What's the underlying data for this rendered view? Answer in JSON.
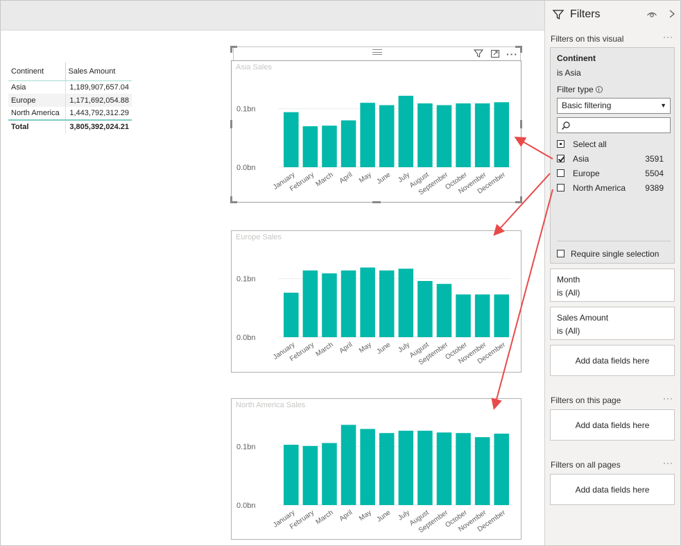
{
  "table": {
    "headers": [
      "Continent",
      "Sales Amount"
    ],
    "rows": [
      [
        "Asia",
        "1,189,907,657.04"
      ],
      [
        "Europe",
        "1,171,692,054.88"
      ],
      [
        "North America",
        "1,443,792,312.29"
      ]
    ],
    "total": [
      "Total",
      "3,805,392,024.21"
    ]
  },
  "charts_meta": {
    "bar_color": "#01b8aa",
    "arrow_color": "#e84a4a"
  },
  "chart_data": [
    {
      "type": "bar",
      "title": "Asia Sales",
      "categories": [
        "January",
        "February",
        "March",
        "April",
        "May",
        "June",
        "July",
        "August",
        "September",
        "October",
        "November",
        "December"
      ],
      "values": [
        0.094,
        0.07,
        0.071,
        0.08,
        0.11,
        0.106,
        0.122,
        0.109,
        0.106,
        0.109,
        0.109,
        0.111
      ],
      "ylim": [
        0,
        0.16
      ],
      "yticks": [
        "0.0bn",
        "0.1bn"
      ],
      "grid": true
    },
    {
      "type": "bar",
      "title": "Europe Sales",
      "categories": [
        "January",
        "February",
        "March",
        "April",
        "May",
        "June",
        "July",
        "August",
        "September",
        "October",
        "November",
        "December"
      ],
      "values": [
        0.076,
        0.114,
        0.109,
        0.114,
        0.119,
        0.114,
        0.117,
        0.096,
        0.091,
        0.073,
        0.073,
        0.073
      ],
      "ylim": [
        0,
        0.16
      ],
      "yticks": [
        "0.0bn",
        "0.1bn"
      ],
      "grid": true
    },
    {
      "type": "bar",
      "title": "North America Sales",
      "categories": [
        "January",
        "February",
        "March",
        "April",
        "May",
        "June",
        "July",
        "August",
        "September",
        "October",
        "November",
        "December"
      ],
      "values": [
        0.103,
        0.101,
        0.106,
        0.137,
        0.13,
        0.123,
        0.127,
        0.127,
        0.124,
        0.123,
        0.116,
        0.122
      ],
      "ylim": [
        0,
        0.16
      ],
      "yticks": [
        "0.0bn",
        "0.1bn"
      ],
      "grid": true
    }
  ],
  "filters": {
    "title": "Filters",
    "on_visual_label": "Filters on this visual",
    "dots": "···",
    "continent": {
      "name": "Continent",
      "state": "is Asia",
      "filter_type_label": "Filter type",
      "filter_type_value": "Basic filtering",
      "select_all": "Select all",
      "options": [
        {
          "label": "Asia",
          "count": "3591",
          "checked": true
        },
        {
          "label": "Europe",
          "count": "5504",
          "checked": false
        },
        {
          "label": "North America",
          "count": "9389",
          "checked": false
        }
      ],
      "require_single": "Require single selection"
    },
    "month": {
      "name": "Month",
      "state": "is (All)"
    },
    "sales_amount": {
      "name": "Sales Amount",
      "state": "is (All)"
    },
    "add_fields": "Add data fields here",
    "on_page_label": "Filters on this page",
    "on_all_pages_label": "Filters on all pages"
  }
}
